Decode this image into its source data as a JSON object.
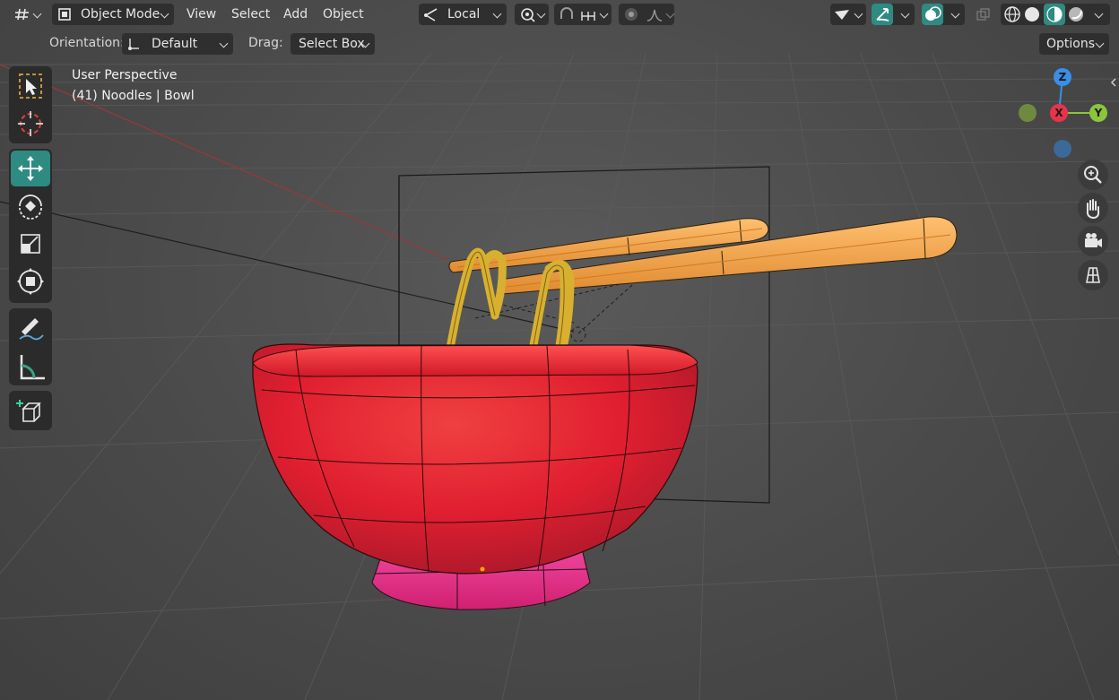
{
  "header": {
    "editor_type_icon": "viewport-editor-icon",
    "mode": {
      "label": "Object Mode",
      "icon": "object-mode-icon"
    },
    "menus": [
      "View",
      "Select",
      "Add",
      "Object"
    ],
    "pivot": {
      "label": "Local",
      "icon": "transform-orientation-icon"
    },
    "snapping_icons": [
      "pivot-point-icon",
      "snap-icon",
      "snap-increment-icon",
      "proportional-edit-icon",
      "falloff-curve-icon"
    ],
    "right_icons": [
      "visibility-icon",
      "gizmo-icon",
      "overlay-icon",
      "xray-icon",
      "wireframe-shading-icon",
      "solid-shading-icon",
      "material-shading-icon",
      "rendered-shading-icon"
    ]
  },
  "tool_settings": {
    "orientation_label": "Orientation:",
    "orientation_value": "Default",
    "drag_label": "Drag:",
    "drag_value": "Select Box",
    "options_label": "Options"
  },
  "viewport": {
    "view_name": "User Perspective",
    "object_info": "(41) Noodles | Bowl"
  },
  "toolbar": {
    "tools": [
      "select-box-icon",
      "cursor-icon",
      "move-icon",
      "rotate-icon",
      "scale-icon",
      "transform-icon",
      "annotate-icon",
      "measure-icon",
      "add-cube-icon"
    ],
    "active_tool": "move-icon"
  },
  "gizmo": {
    "axes": [
      "Z",
      "X",
      "Y"
    ]
  },
  "navigation": [
    "zoom-icon",
    "pan-hand-icon",
    "camera-view-icon",
    "orthographic-grid-icon"
  ],
  "colors": {
    "active_tool": "#2e8b82",
    "axis_x": "#e8344a",
    "axis_y": "#8bc63a",
    "axis_z": "#3a8ee6",
    "bowl": "#e0232e",
    "bowl_base": "#e0307a",
    "chopsticks": "#f0a040",
    "noodles": "#d8b030"
  }
}
